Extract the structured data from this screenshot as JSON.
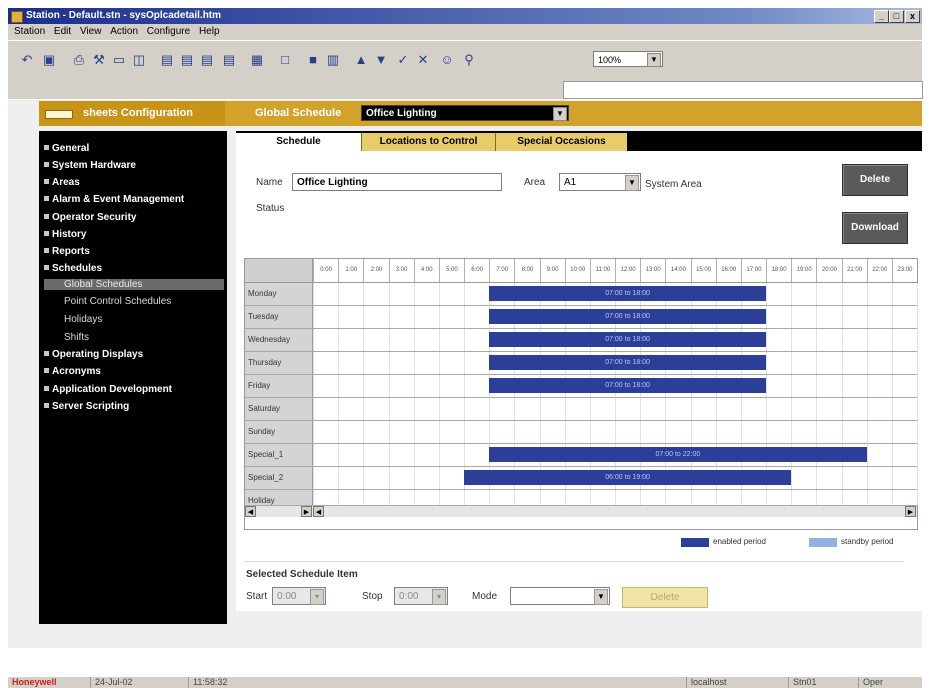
{
  "window": {
    "title": "Station - Default.stn - sysOplcadetail.htm",
    "controls": [
      "_",
      "□",
      "x"
    ]
  },
  "menu": [
    "Station",
    "Edit",
    "View",
    "Action",
    "Configure",
    "Help"
  ],
  "toolbar": {
    "icons": [
      "back-icon",
      "home-icon",
      "print-icon",
      "tools-icon",
      "window-icon",
      "grid-icon",
      "copy-icon",
      "paste-icon",
      "export-icon",
      "chart-icon",
      "table-icon",
      "panel-icon",
      "block-icon",
      "bars-icon",
      "up-arrow-icon",
      "down-arrow-icon",
      "check-icon",
      "cancel-icon",
      "users-icon",
      "search-icon"
    ],
    "zoom": "100%"
  },
  "header": {
    "config_title": "sheets Configuration",
    "schedule_label": "Global Schedule",
    "schedule_selected": "Office Lighting"
  },
  "sidebar": {
    "items": [
      {
        "label": "General"
      },
      {
        "label": "System Hardware"
      },
      {
        "label": "Areas"
      },
      {
        "label": "Alarm & Event Management"
      },
      {
        "label": "Operator Security"
      },
      {
        "label": "History"
      },
      {
        "label": "Reports"
      },
      {
        "label": "Schedules"
      },
      {
        "label": "Operating Displays"
      },
      {
        "label": "Acronyms"
      },
      {
        "label": "Application Development"
      },
      {
        "label": "Server Scripting"
      }
    ],
    "schedule_subitems": [
      {
        "label": "Global Schedules",
        "selected": true
      },
      {
        "label": "Point Control Schedules",
        "selected": false
      },
      {
        "label": "Holidays",
        "selected": false
      },
      {
        "label": "Shifts",
        "selected": false
      }
    ]
  },
  "tabs": [
    {
      "label": "Schedule",
      "active": true
    },
    {
      "label": "Locations to Control",
      "active": false
    },
    {
      "label": "Special Occasions",
      "active": false
    }
  ],
  "form": {
    "name_label": "Name",
    "name_value": "Office Lighting",
    "area_label": "Area",
    "area_value": "A1",
    "area_desc": "System Area",
    "status_label": "Status",
    "delete_label": "Delete",
    "download_label": "Download"
  },
  "grid": {
    "hours": [
      "0:00",
      "1:00",
      "2:00",
      "3:00",
      "4:00",
      "5:00",
      "6:00",
      "7:00",
      "8:00",
      "9:00",
      "10:00",
      "11:00",
      "12:00",
      "13:00",
      "14:00",
      "15:00",
      "16:00",
      "17:00",
      "18:00",
      "19:00",
      "20:00",
      "21:00",
      "22:00",
      "23:00"
    ],
    "rows": [
      {
        "day": "Monday",
        "start": 7,
        "end": 18,
        "label": "07:00 to 18:00"
      },
      {
        "day": "Tuesday",
        "start": 7,
        "end": 18,
        "label": "07:00 to 18:00"
      },
      {
        "day": "Wednesday",
        "start": 7,
        "end": 18,
        "label": "07:00 to 18:00"
      },
      {
        "day": "Thursday",
        "start": 7,
        "end": 18,
        "label": "07:00 to 18:00"
      },
      {
        "day": "Friday",
        "start": 7,
        "end": 18,
        "label": "07:00 to 18:00"
      },
      {
        "day": "Saturday",
        "start": null,
        "end": null,
        "label": ""
      },
      {
        "day": "Sunday",
        "start": null,
        "end": null,
        "label": ""
      },
      {
        "day": "Special_1",
        "start": 7,
        "end": 22,
        "label": "07:00 to 22:00"
      },
      {
        "day": "Special_2",
        "start": 6,
        "end": 19,
        "label": "06:00 to 19:00"
      },
      {
        "day": "Holiday",
        "start": null,
        "end": null,
        "label": ""
      }
    ]
  },
  "legend": {
    "enabled_label": "enabled period",
    "standby_label": "standby period",
    "enabled_color": "#2b3f99",
    "standby_color": "#8fb2e0"
  },
  "selected_item": {
    "title": "Selected Schedule Item",
    "start_label": "Start",
    "start_value": "0:00",
    "stop_label": "Stop",
    "stop_value": "0:00",
    "mode_label": "Mode",
    "mode_value": "",
    "delete_label": "Delete"
  },
  "statusbar": {
    "brand": "Honeywell",
    "date": "24-Jul-02",
    "time": "11:58:32",
    "host": "localhost",
    "station": "Stn01",
    "mode": "Oper"
  }
}
